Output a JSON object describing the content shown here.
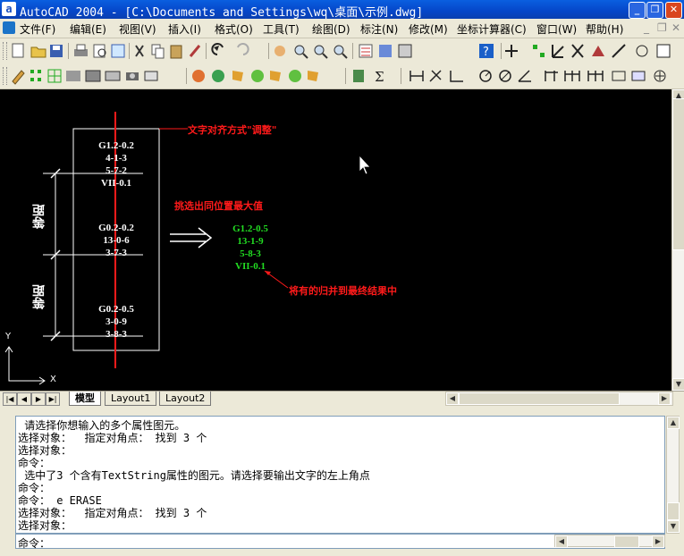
{
  "window": {
    "title": "AutoCAD 2004 - [C:\\Documents and Settings\\wq\\桌面\\示例.dwg]",
    "app_icon_text": "a",
    "minimize": "_",
    "restore": "❐",
    "close": "✕"
  },
  "menu": {
    "items": [
      "文件(F)",
      "编辑(E)",
      "视图(V)",
      "插入(I)",
      "格式(O)",
      "工具(T)",
      "绘图(D)",
      "标注(N)",
      "修改(M)",
      "坐标计算器(C)",
      "窗口(W)",
      "帮助(H)"
    ],
    "doc_min": "_",
    "doc_restore": "❐",
    "doc_close": "✕"
  },
  "drawing": {
    "block_top": [
      "G1.2-0.2",
      "4-1-3",
      "5-7-2",
      "VII-0.1"
    ],
    "block_mid": [
      "G0.2-0.2",
      "13-0-6",
      "3-7-3"
    ],
    "block_bot": [
      "G0.2-0.5",
      "3-0-9",
      "3-8-3"
    ],
    "result": [
      "G1.2-0.5",
      "13-1-9",
      "5-8-3",
      "VII-0.1"
    ],
    "label_equal_1": "等距",
    "label_equal_2": "等距",
    "note_align": "文字对齐方式\"调整\"",
    "note_pick_max": "挑选出同位置最大值",
    "note_merge": "将有的归并到最终结果中",
    "axis_y": "Y",
    "axis_x": "X",
    "colors": {
      "red": "#ff1a1a",
      "green": "#22dd22",
      "white": "#ffffff",
      "background": "#000000"
    }
  },
  "tabs": [
    "模型",
    "Layout1",
    "Layout2"
  ],
  "tabs_active": "模型",
  "command_log": [
    " 请选择你想输入的多个属性图元。",
    "选择对象：  指定对角点： 找到 3 个",
    "选择对象：",
    "命令：",
    " 选中了3 个含有TextString属性的图元。请选择要输出文字的左上角点",
    "命令：",
    "命令： e ERASE",
    "选择对象：  指定对角点： 找到 3 个",
    "选择对象："
  ],
  "command_prompt": "命令："
}
